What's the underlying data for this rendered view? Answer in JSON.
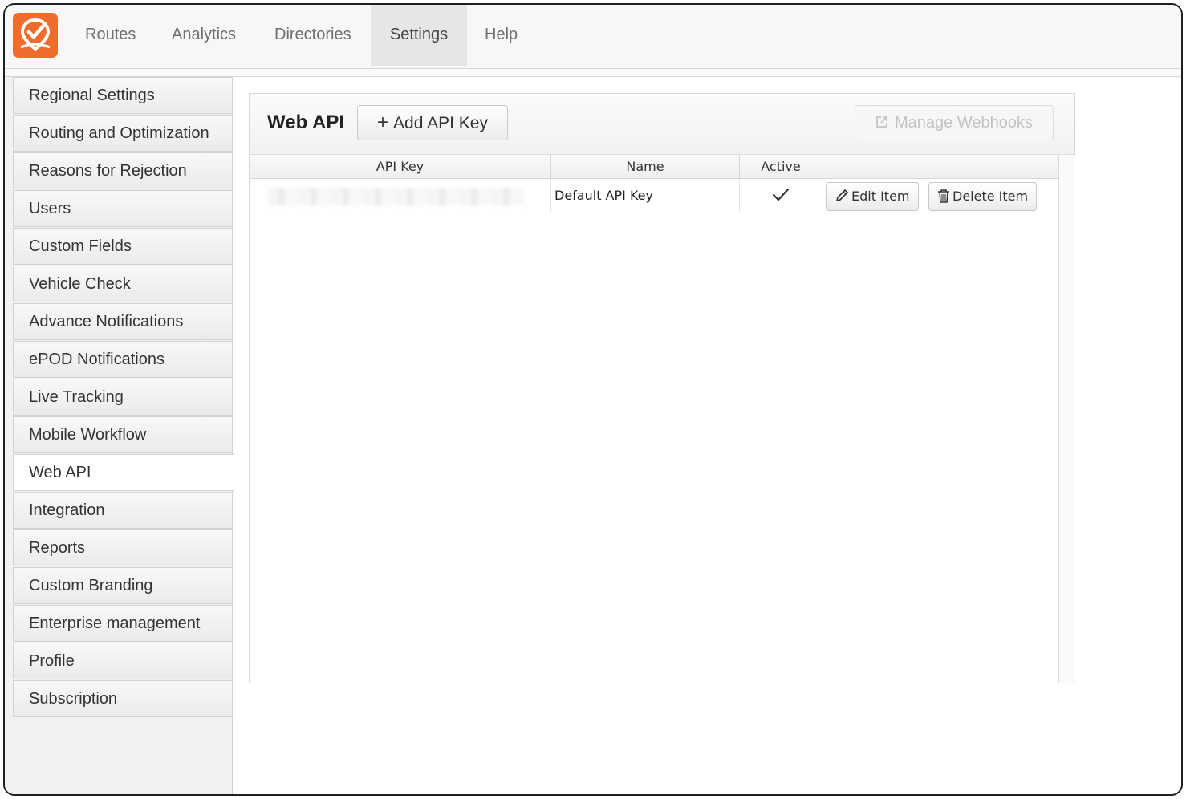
{
  "nav": {
    "items": [
      {
        "label": "Routes",
        "active": false
      },
      {
        "label": "Analytics",
        "active": false
      },
      {
        "label": "Directories",
        "active": false
      },
      {
        "label": "Settings",
        "active": true
      },
      {
        "label": "Help",
        "active": false
      }
    ]
  },
  "sidebar": {
    "items": [
      {
        "label": "Regional Settings"
      },
      {
        "label": "Routing and Optimization"
      },
      {
        "label": "Reasons for Rejection"
      },
      {
        "label": "Users"
      },
      {
        "label": "Custom Fields"
      },
      {
        "label": "Vehicle Check"
      },
      {
        "label": "Advance Notifications"
      },
      {
        "label": "ePOD Notifications"
      },
      {
        "label": "Live Tracking"
      },
      {
        "label": "Mobile Workflow"
      },
      {
        "label": "Web API",
        "active": true
      },
      {
        "label": "Integration"
      },
      {
        "label": "Reports"
      },
      {
        "label": "Custom Branding"
      },
      {
        "label": "Enterprise management"
      },
      {
        "label": "Profile"
      },
      {
        "label": "Subscription"
      }
    ]
  },
  "panel": {
    "title": "Web API",
    "add_button": "Add API Key",
    "webhooks_button": "Manage Webhooks",
    "table": {
      "headers": [
        "API Key",
        "Name",
        "Active",
        ""
      ],
      "rows": [
        {
          "api_key": "",
          "name": "Default API Key",
          "active": true,
          "edit_label": "Edit Item",
          "delete_label": "Delete Item"
        }
      ]
    }
  },
  "colors": {
    "brand": "#ef6d2c",
    "active_nav": "#e6e6e6",
    "disabled_text": "#c3c3c3"
  }
}
